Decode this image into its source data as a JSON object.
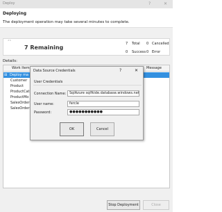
{
  "window": {
    "title": "Deploy",
    "help": "?",
    "close": "✕"
  },
  "header": {
    "title": "Deploying",
    "subtitle": "The deployment operation may take several minutes to complete."
  },
  "summary": {
    "spinner": "ˆˆ",
    "remaining": "7 Remaining",
    "total_count": "7",
    "total_label": "Total",
    "success_count": "0",
    "success_label": "Success",
    "cancelled_count": "0",
    "cancelled_label": "Cancelled",
    "error_count": "0",
    "error_label": "Error"
  },
  "details": {
    "label": "Details:",
    "columns": [
      "Work Item",
      "Message"
    ],
    "rows": [
      "Deploy ma",
      "Customer",
      "Product",
      "ProductCat",
      "ProductMo",
      "SalesOrder",
      "SalesOrder"
    ],
    "row_icon": "⊞"
  },
  "buttons": {
    "stop": "Stop Deployment",
    "close": "Close"
  },
  "dialog": {
    "title": "Data Source Credentials",
    "help": "?",
    "close": "✕",
    "group_label": "User Credentials",
    "connection_label": "Connection Name:",
    "connection_value": "SqlAzure sqlfkide.database.windows.net e",
    "username_label": "User name:",
    "username_value": "fercle",
    "password_label": "Password:",
    "password_value": "●●●●●●●●●●●",
    "ok": "OK",
    "cancel": "Cancel"
  }
}
